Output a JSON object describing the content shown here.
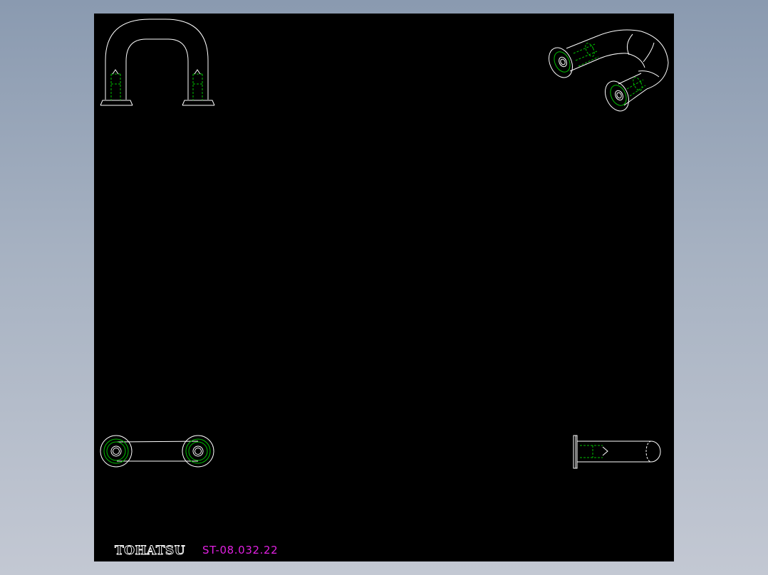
{
  "drawing": {
    "brand_text": "TOHATSU",
    "part_number": "ST-08.032.22"
  },
  "colors": {
    "background_gradient_top": "#8a9ab0",
    "background_gradient_bottom": "#c3c8d3",
    "viewport_background": "#000000",
    "outline_line": "#ffffff",
    "hidden_line": "#00c000",
    "part_number_text": "#e020e0"
  },
  "views": [
    {
      "name": "front-view"
    },
    {
      "name": "isometric-view"
    },
    {
      "name": "top-view"
    },
    {
      "name": "side-view"
    }
  ]
}
